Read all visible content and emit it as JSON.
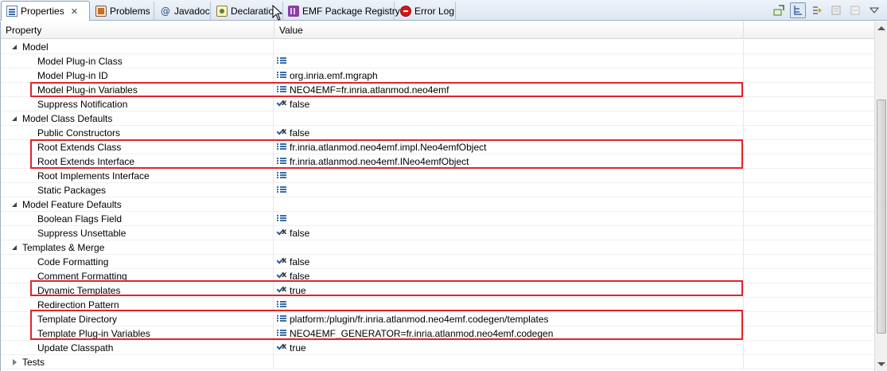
{
  "tabs": [
    {
      "label": "Properties",
      "icon": "properties-icon",
      "active": true,
      "closable": true
    },
    {
      "label": "Problems",
      "icon": "problems-icon"
    },
    {
      "label": "Javadoc",
      "icon": "javadoc-icon"
    },
    {
      "label": "Declaration",
      "icon": "declaration-icon"
    },
    {
      "label": "EMF Package Registry",
      "icon": "emf-registry-icon"
    },
    {
      "label": "Error Log",
      "icon": "error-log-icon"
    }
  ],
  "close_glyph": "✕",
  "toolbar": {
    "buttons": [
      "pin-icon",
      "show-categories-icon",
      "show-advanced-icon",
      "filter-icon",
      "restore-default-icon",
      "view-menu-icon"
    ]
  },
  "table": {
    "headers": {
      "property": "Property",
      "value": "Value"
    },
    "rows": [
      {
        "type": "category",
        "label": "Model",
        "expanded": true
      },
      {
        "type": "property",
        "label": "Model Plug-in Class",
        "icon": "list",
        "value": ""
      },
      {
        "type": "property",
        "label": "Model Plug-in ID",
        "icon": "list",
        "value": "org.inria.emf.mgraph"
      },
      {
        "type": "property",
        "label": "Model Plug-in Variables",
        "icon": "list",
        "value": "NEO4EMF=fr.inria.atlanmod.neo4emf"
      },
      {
        "type": "property",
        "label": "Suppress Notification",
        "icon": "bool",
        "value": "false"
      },
      {
        "type": "category",
        "label": "Model Class Defaults",
        "expanded": true
      },
      {
        "type": "property",
        "label": "Public Constructors",
        "icon": "bool",
        "value": "false"
      },
      {
        "type": "property",
        "label": "Root Extends Class",
        "icon": "list",
        "value": "fr.inria.atlanmod.neo4emf.impl.Neo4emfObject"
      },
      {
        "type": "property",
        "label": "Root Extends Interface",
        "icon": "list",
        "value": "fr.inria.atlanmod.neo4emf.INeo4emfObject"
      },
      {
        "type": "property",
        "label": "Root Implements Interface",
        "icon": "list",
        "value": ""
      },
      {
        "type": "property",
        "label": "Static Packages",
        "icon": "list",
        "value": ""
      },
      {
        "type": "category",
        "label": "Model Feature Defaults",
        "expanded": true
      },
      {
        "type": "property",
        "label": "Boolean Flags Field",
        "icon": "list",
        "value": ""
      },
      {
        "type": "property",
        "label": "Suppress Unsettable",
        "icon": "bool",
        "value": "false"
      },
      {
        "type": "category",
        "label": "Templates & Merge",
        "expanded": true
      },
      {
        "type": "property",
        "label": "Code Formatting",
        "icon": "bool",
        "value": "false"
      },
      {
        "type": "property",
        "label": "Comment Formatting",
        "icon": "bool",
        "value": "false"
      },
      {
        "type": "property",
        "label": "Dynamic Templates",
        "icon": "bool",
        "value": "true"
      },
      {
        "type": "property",
        "label": "Redirection Pattern",
        "icon": "list",
        "value": ""
      },
      {
        "type": "property",
        "label": "Template Directory",
        "icon": "list",
        "value": "platform:/plugin/fr.inria.atlanmod.neo4emf.codegen/templates"
      },
      {
        "type": "property",
        "label": "Template Plug-in Variables",
        "icon": "list",
        "value": "NEO4EMF_GENERATOR=fr.inria.atlanmod.neo4emf.codegen"
      },
      {
        "type": "property",
        "label": "Update Classpath",
        "icon": "bool",
        "value": "true"
      },
      {
        "type": "category",
        "label": "Tests",
        "expanded": false
      }
    ]
  },
  "highlight_color": "#e0252a"
}
